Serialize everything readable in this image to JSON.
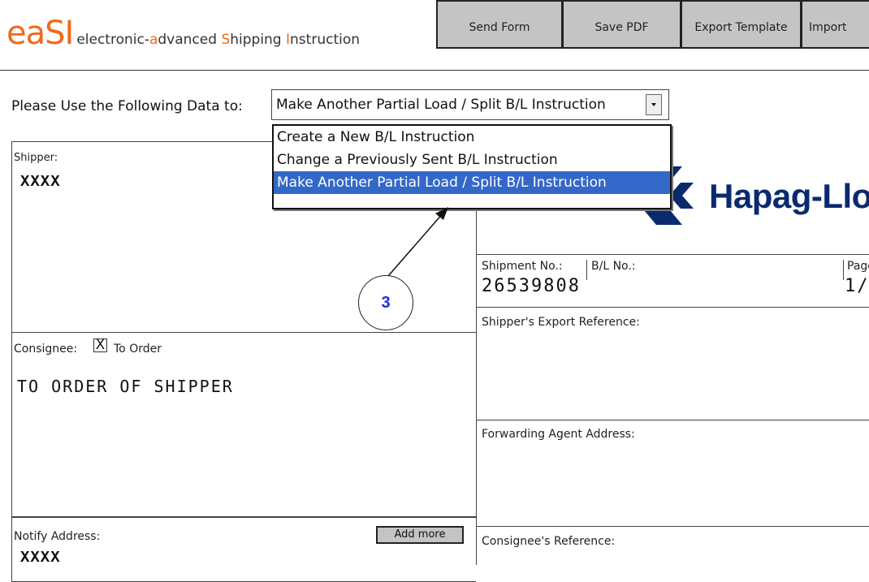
{
  "logo": {
    "mark": "eaSI",
    "parts": [
      {
        "t": "electronic-",
        "hl": false
      },
      {
        "t": "a",
        "hl": true
      },
      {
        "t": "dvanced ",
        "hl": false
      },
      {
        "t": "S",
        "hl": true
      },
      {
        "t": "hipping ",
        "hl": false
      },
      {
        "t": "I",
        "hl": true
      },
      {
        "t": "nstruction",
        "hl": false
      }
    ]
  },
  "toolbar": {
    "send_form": "Send Form",
    "save_pdf": "Save PDF",
    "export_template": "Export Template",
    "import": "Import"
  },
  "action": {
    "label": "Please Use the Following Data to:",
    "selected": "Make Another Partial Load / Split B/L Instruction",
    "options": [
      "Create a New B/L Instruction",
      "Change a Previously Sent B/L Instruction",
      "Make Another Partial Load / Split B/L Instruction"
    ],
    "highlighted_index": 2
  },
  "shipper": {
    "label": "Shipper:",
    "value": "XXXX"
  },
  "consignee": {
    "label": "Consignee:",
    "checkbox_mark": "X",
    "to_order_label": "To Order",
    "value": "TO ORDER OF SHIPPER"
  },
  "notify": {
    "label": "Notify Address:",
    "add_more": "Add more",
    "value": "XXXX"
  },
  "shipment": {
    "label": "Shipment No.:",
    "value": "26539808"
  },
  "bl": {
    "label": "B/L No.:"
  },
  "page": {
    "label": "Page:",
    "value": "1/"
  },
  "export_ref": {
    "label": "Shipper's Export Reference:"
  },
  "forwarding": {
    "label": "Forwarding Agent Address:"
  },
  "consignee_ref": {
    "label": "Consignee's Reference:"
  },
  "brand": {
    "name": "Hapag-Llo"
  },
  "callout": {
    "number": "3"
  },
  "colors": {
    "accent": "#ef6a1a",
    "selection": "#3468c8",
    "brand": "#0a2a6e",
    "callout_text": "#1a2fd6",
    "button": "#c4c4c4"
  },
  "icons": {
    "dropdown": "dropdown-arrow-icon",
    "brand_logo": "hapag-lloyd-logo-icon"
  }
}
